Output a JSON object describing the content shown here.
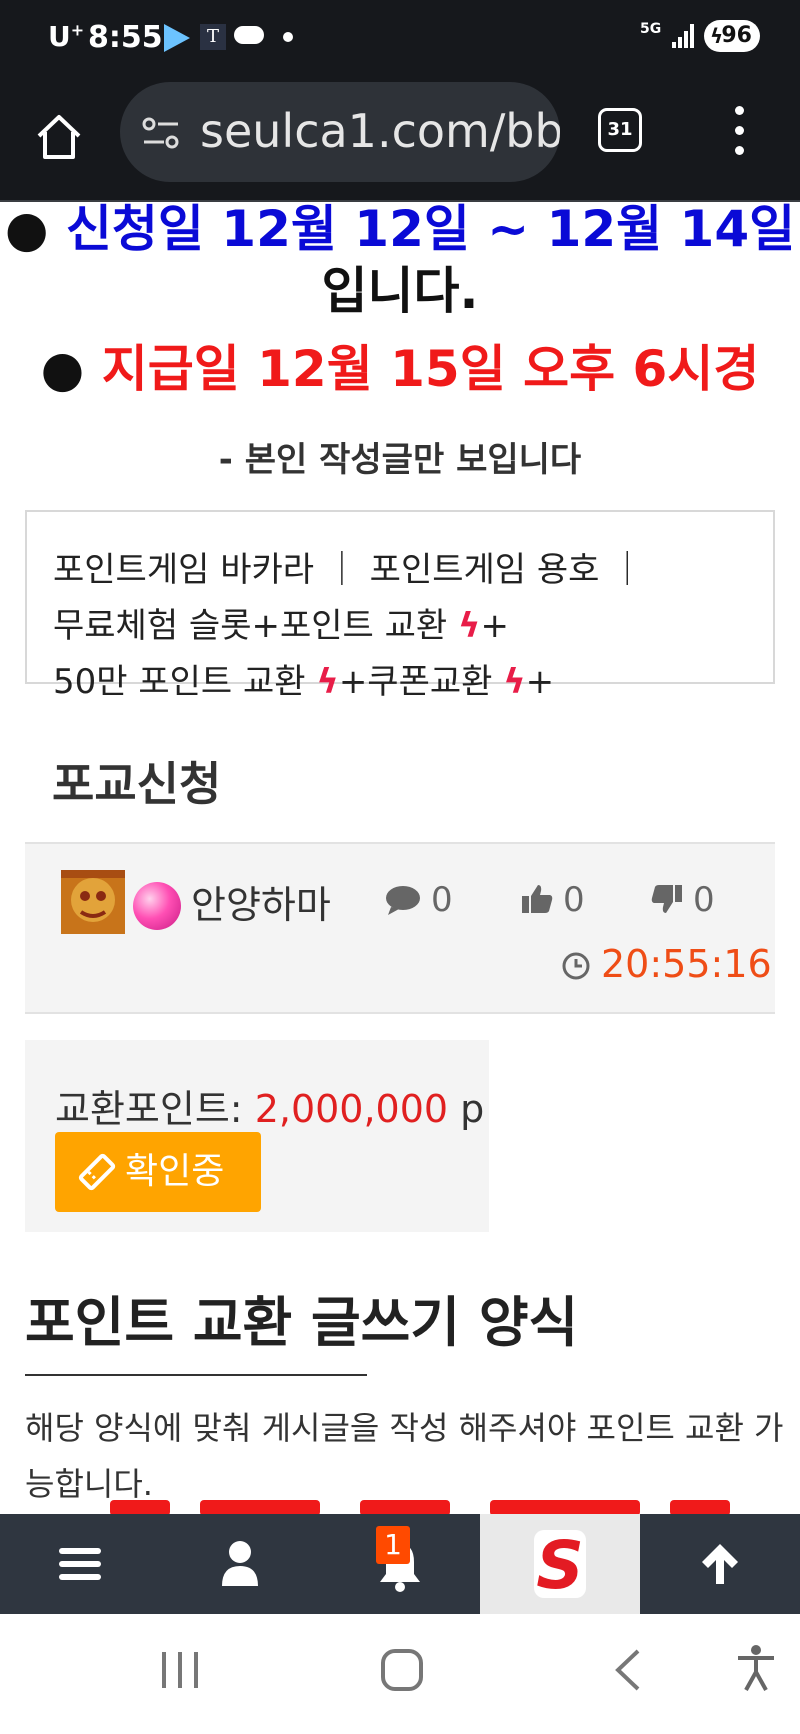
{
  "status_bar": {
    "carrier": "U",
    "carrier_sup": "+",
    "time": "8:55",
    "app_t": "T",
    "network": "5G",
    "battery": "96"
  },
  "browser": {
    "url": "seulca1.com/bb",
    "tab_count": "31"
  },
  "notice": {
    "bullet": "●",
    "apply_line_blue": "신청일 12월 12일 ~ 12월 14일",
    "apply_line_black": "입니다.",
    "pay_line": "지급일 12월 15일 오후 6시경",
    "own_posts": "- 본인 작성글만 보입니다"
  },
  "games": {
    "line1": "포인트게임 바카라 ｜ 포인트게임 용호 ｜",
    "line2_text": "무료체험 슬롯+포인트 교환 ",
    "line2_tail": "+",
    "line3_text": "50만 포인트 교환 ",
    "line3_mid": "+쿠폰교환 ",
    "line3_tail": "+",
    "bolt": "ϟ"
  },
  "board": {
    "title": "포교신청"
  },
  "post": {
    "author": "안양하마",
    "comments": "0",
    "likes": "0",
    "dislikes": "0",
    "time": "20:55:16"
  },
  "exchange": {
    "label": "교환포인트: ",
    "amount": "2,000,000",
    "unit": " p",
    "status": "확인중"
  },
  "form": {
    "title": "포인트 교환 글쓰기 양식",
    "desc": "해당 양식에 맞춰 게시글을 작성 해주셔야 포인트 교환 가능합니다."
  },
  "bottom_nav": {
    "notification_count": "1",
    "logo_letter": "S"
  },
  "colors": {
    "apply_blue": "#0a0ad6",
    "pay_red": "#f01a1a",
    "time_orange": "#ef4d16",
    "amount_red": "#e02020",
    "status_orange": "#ffa400",
    "nav_bg": "#2f3640",
    "badge": "#ff4a00"
  }
}
